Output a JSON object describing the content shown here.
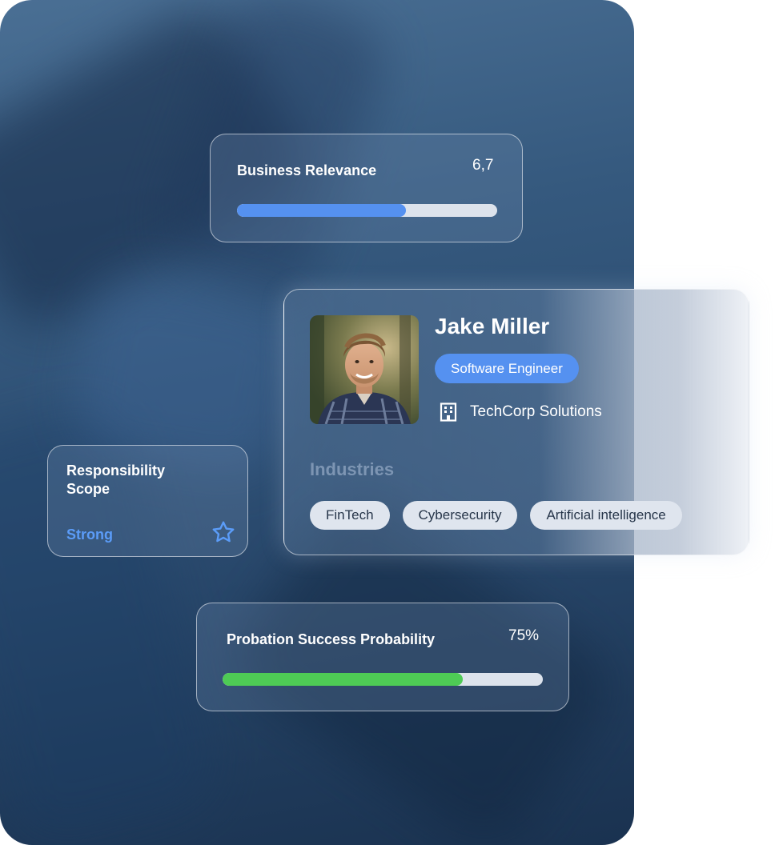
{
  "business_relevance": {
    "title": "Business Relevance",
    "value": "6,7",
    "progress_fraction": 0.65,
    "bar_color": "#5591f0"
  },
  "responsibility_scope": {
    "title": "Responsibility Scope",
    "value": "Strong",
    "icon": "star-icon",
    "accent_color": "#5b9cf8"
  },
  "profile": {
    "name": "Jake Miller",
    "role": "Software Engineer",
    "company_icon": "building-icon",
    "company": "TechCorp Solutions",
    "industries_label": "Industries",
    "industries": [
      "FinTech",
      "Cybersecurity",
      "Artificial intelligence"
    ]
  },
  "probation": {
    "title": "Probation Success Probability",
    "value": "75%",
    "progress_fraction": 0.75,
    "bar_color": "#4ecb55"
  }
}
